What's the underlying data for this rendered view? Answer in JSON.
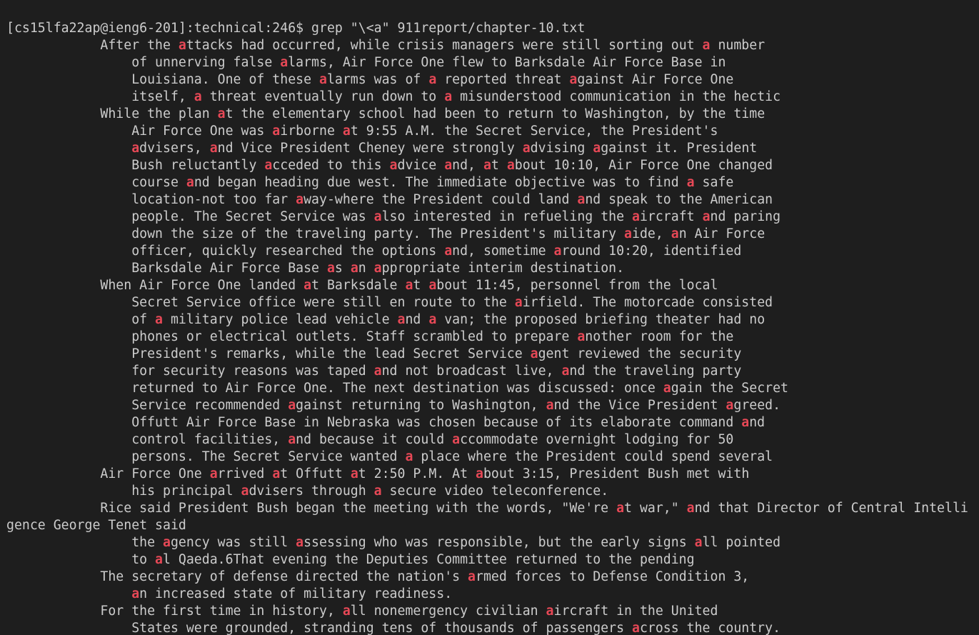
{
  "colors": {
    "background": "#1e1e1e",
    "text": "#cccccc",
    "match_highlight": "#e74856"
  },
  "terminal": {
    "prompt": "[cs15lfa22ap@ieng6-201]:technical:246$",
    "command": "grep \"\\<a\" 911report/chapter-10.txt",
    "output_lines": [
      "            After the attacks had occurred, while crisis managers were still sorting out a number",
      "                of unnerving false alarms, Air Force One flew to Barksdale Air Force Base in",
      "                Louisiana. One of these alarms was of a reported threat against Air Force One",
      "                itself, a threat eventually run down to a misunderstood communication in the hectic",
      "            While the plan at the elementary school had been to return to Washington, by the time",
      "                Air Force One was airborne at 9:55 A.M. the Secret Service, the President's",
      "                advisers, and Vice President Cheney were strongly advising against it. President",
      "                Bush reluctantly acceded to this advice and, at about 10:10, Air Force One changed",
      "                course and began heading due west. The immediate objective was to find a safe",
      "                location-not too far away-where the President could land and speak to the American",
      "                people. The Secret Service was also interested in refueling the aircraft and paring",
      "                down the size of the traveling party. The President's military aide, an Air Force",
      "                officer, quickly researched the options and, sometime around 10:20, identified",
      "                Barksdale Air Force Base as an appropriate interim destination.",
      "            When Air Force One landed at Barksdale at about 11:45, personnel from the local",
      "                Secret Service office were still en route to the airfield. The motorcade consisted",
      "                of a military police lead vehicle and a van; the proposed briefing theater had no",
      "                phones or electrical outlets. Staff scrambled to prepare another room for the",
      "                President's remarks, while the lead Secret Service agent reviewed the security",
      "                for security reasons was taped and not broadcast live, and the traveling party",
      "                returned to Air Force One. The next destination was discussed: once again the Secret",
      "                Service recommended against returning to Washington, and the Vice President agreed.",
      "                Offutt Air Force Base in Nebraska was chosen because of its elaborate command and",
      "                control facilities, and because it could accommodate overnight lodging for 50",
      "                persons. The Secret Service wanted a place where the President could spend several",
      "            Air Force One arrived at Offutt at 2:50 P.M. At about 3:15, President Bush met with",
      "                his principal advisers through a secure video teleconference.",
      "            Rice said President Bush began the meeting with the words, \"We're at war,\" and that Director of Central Intelli",
      "gence George Tenet said",
      "                the agency was still assessing who was responsible, but the early signs all pointed",
      "                to al Qaeda.6That evening the Deputies Committee returned to the pending",
      "            The secretary of defense directed the nation's armed forces to Defense Condition 3,",
      "                an increased state of military readiness.",
      "            For the first time in history, all nonemergency civilian aircraft in the United",
      "                States were grounded, stranding tens of thousands of passengers across the country."
    ]
  }
}
